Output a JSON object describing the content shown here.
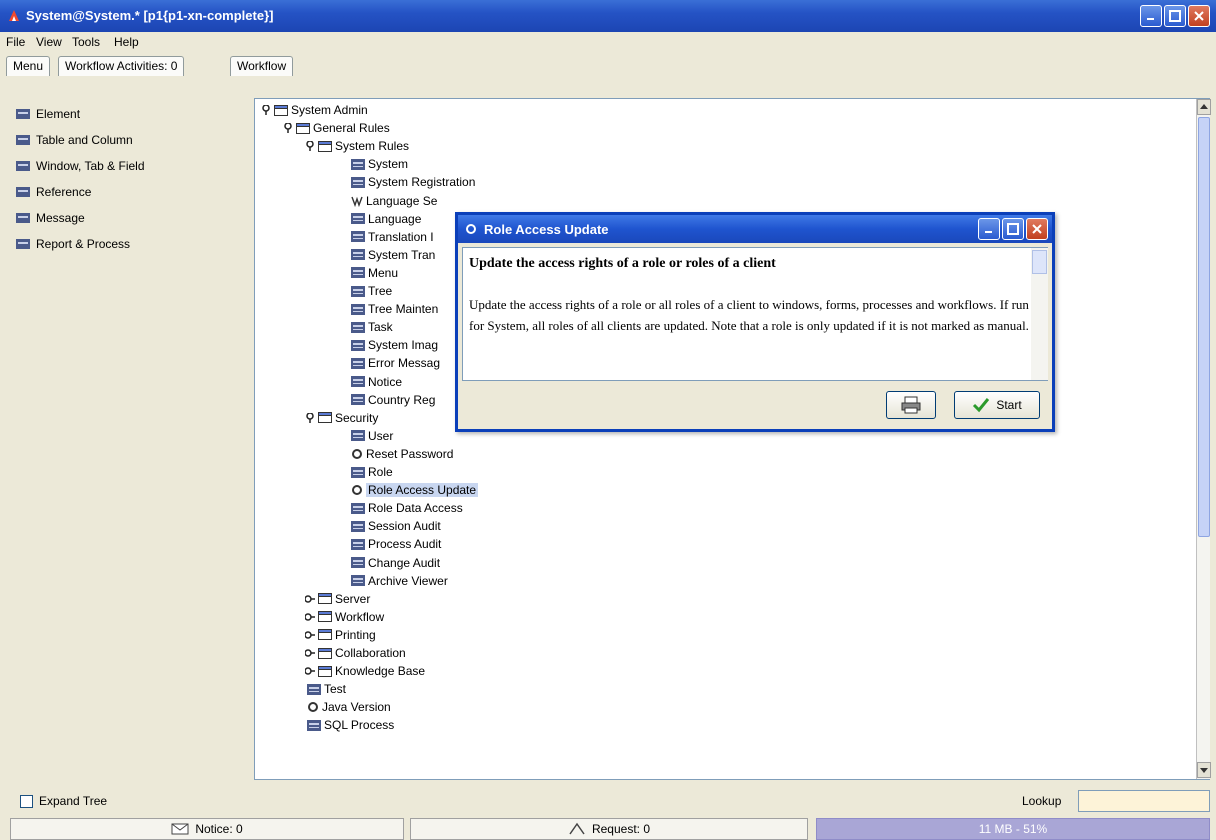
{
  "window": {
    "title": "System@System.* [p1{p1-xn-complete}]"
  },
  "menubar": {
    "file": "File",
    "view": "View",
    "tools": "Tools",
    "help": "Help"
  },
  "tabs": [
    {
      "label": "Menu"
    },
    {
      "label": "Workflow Activities: 0"
    },
    {
      "label": "Workflow"
    }
  ],
  "left_menu": [
    {
      "label": "Element"
    },
    {
      "label": "Table and Column"
    },
    {
      "label": "Window, Tab & Field"
    },
    {
      "label": "Reference"
    },
    {
      "label": "Message"
    },
    {
      "label": "Report & Process"
    }
  ],
  "tree": [
    {
      "label": "System Admin",
      "type": "folder",
      "expanded": true
    },
    {
      "label": "General Rules",
      "type": "folder",
      "expanded": true
    },
    {
      "label": "System Rules",
      "type": "folder",
      "expanded": true
    },
    {
      "label": "System",
      "type": "window"
    },
    {
      "label": "System Registration",
      "type": "window"
    },
    {
      "label": "Language Se",
      "type": "workflow"
    },
    {
      "label": "Language",
      "type": "window"
    },
    {
      "label": "Translation I",
      "type": "window"
    },
    {
      "label": "System Tran",
      "type": "window"
    },
    {
      "label": "Menu",
      "type": "window"
    },
    {
      "label": "Tree",
      "type": "window"
    },
    {
      "label": "Tree Mainten",
      "type": "window"
    },
    {
      "label": "Task",
      "type": "window"
    },
    {
      "label": "System Imag",
      "type": "window"
    },
    {
      "label": "Error Messag",
      "type": "window"
    },
    {
      "label": "Notice",
      "type": "window"
    },
    {
      "label": "Country Reg",
      "type": "window"
    },
    {
      "label": "Security",
      "type": "folder",
      "expanded": true
    },
    {
      "label": "User",
      "type": "window"
    },
    {
      "label": "Reset Password",
      "type": "process"
    },
    {
      "label": "Role",
      "type": "window"
    },
    {
      "label": "Role Access Update",
      "type": "process",
      "selected": true
    },
    {
      "label": "Role Data Access",
      "type": "window"
    },
    {
      "label": "Session Audit",
      "type": "window"
    },
    {
      "label": "Process Audit",
      "type": "window"
    },
    {
      "label": "Change Audit",
      "type": "window"
    },
    {
      "label": "Archive Viewer",
      "type": "window"
    },
    {
      "label": "Server",
      "type": "folder",
      "expanded": false
    },
    {
      "label": "Workflow",
      "type": "folder",
      "expanded": false
    },
    {
      "label": "Printing",
      "type": "folder",
      "expanded": false
    },
    {
      "label": "Collaboration",
      "type": "folder",
      "expanded": false
    },
    {
      "label": "Knowledge Base",
      "type": "folder",
      "expanded": false
    },
    {
      "label": "Test",
      "type": "window"
    },
    {
      "label": "Java Version",
      "type": "process"
    },
    {
      "label": "SQL Process",
      "type": "window"
    }
  ],
  "dialog": {
    "title": "Role Access Update",
    "heading": "Update the access rights of a role or roles of a client",
    "description": "Update the access rights of a role or all roles of a client to windows, forms, processes and workflows. If run for System, all roles of all clients are updated. Note that a role is only updated if it is not marked as manual.",
    "start_label": "Start",
    "print_icon": "printer-icon",
    "start_icon": "checkmark-icon"
  },
  "bottom": {
    "expand_tree": "Expand Tree",
    "lookup": "Lookup"
  },
  "status": {
    "notice": "Notice: 0",
    "request": "Request: 0",
    "memory": "11 MB - 51%"
  },
  "colors": {
    "title_bar": "#2553c5",
    "dialog_border": "#0b3fb9",
    "selection": "#c8d6f0",
    "lookup_field": "#fdf3d8",
    "memory_bar": "#a9a6d6"
  }
}
